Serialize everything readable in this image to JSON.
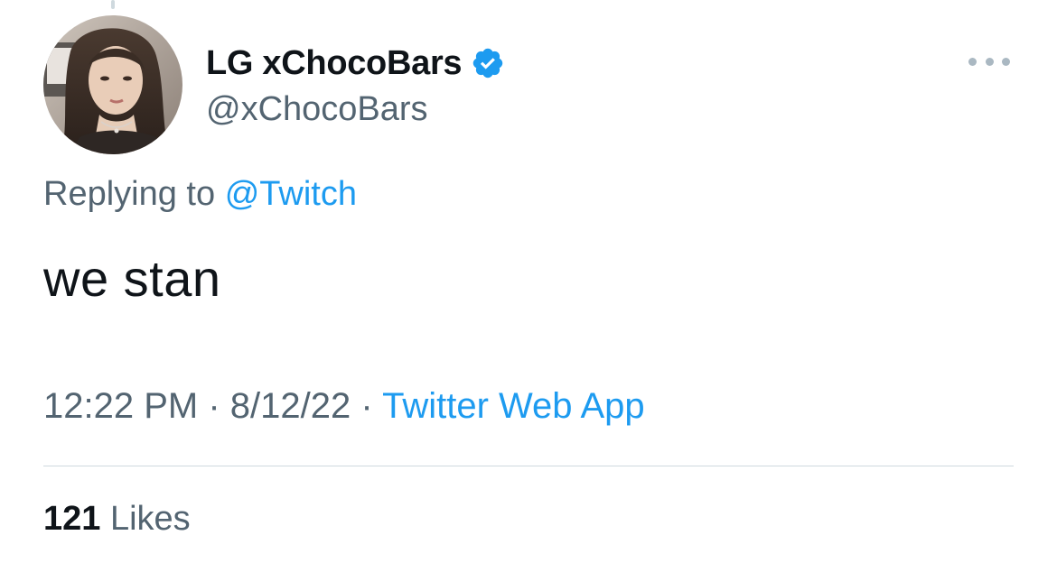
{
  "author": {
    "display_name": "LG xChocoBars",
    "handle": "@xChocoBars",
    "verified": true,
    "avatar_icon": "profile-photo"
  },
  "reply": {
    "prefix": "Replying to",
    "mention": "@Twitch"
  },
  "tweet": {
    "text": "we stan"
  },
  "meta": {
    "time": "12:22 PM",
    "separator": "·",
    "date": "8/12/22",
    "source": "Twitter Web App"
  },
  "stats": {
    "likes_count": "121",
    "likes_label": "Likes"
  },
  "colors": {
    "accent": "#1d9bf0",
    "secondary_text": "#536471",
    "primary_text": "#0f1419",
    "divider": "#cfd9de"
  },
  "icons": {
    "verified": "verified-badge-icon",
    "more": "more-options-icon"
  }
}
